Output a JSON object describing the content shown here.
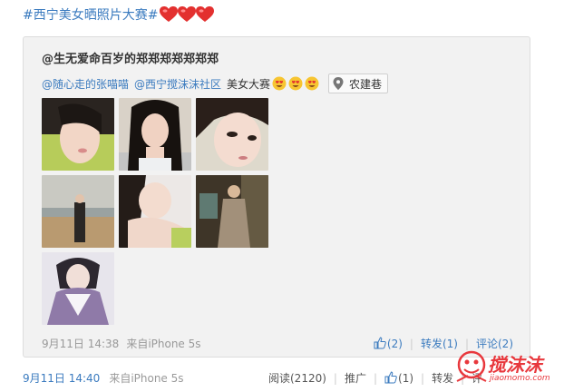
{
  "post": {
    "hashtag": "#西宁美女晒照片大赛#",
    "hearts": [
      "heart",
      "heart",
      "heart"
    ]
  },
  "repost": {
    "author": "@生无爱命百岁的郑郑郑郑郑郑郑",
    "mentions": [
      "@随心走的张喵喵",
      "@西宁搅沫沫社区"
    ],
    "text": "美女大赛",
    "emojis": [
      "heart-eyes",
      "heart-eyes",
      "heart-eyes"
    ],
    "location": "农建巷",
    "images": [
      "photo-1",
      "photo-2",
      "photo-3",
      "photo-4",
      "photo-5",
      "photo-6",
      "photo-7"
    ],
    "time": "9月11日 14:38",
    "source": "来自iPhone 5s",
    "like_count": "(2)",
    "repost_label": "转发(1)",
    "comment_label": "评论(2)"
  },
  "footer": {
    "time": "9月11日 14:40",
    "source": "来自iPhone 5s",
    "read_label": "阅读(2120)",
    "promote_label": "推广",
    "like_count": "(1)",
    "repost_label": "转发",
    "comment_label": "评"
  },
  "watermark": {
    "text": "搅沫沫",
    "url": "jiaomomo.com"
  },
  "colors": {
    "link": "#3b7bbf",
    "card_bg": "#f2f2f2",
    "watermark": "#e8383d"
  }
}
